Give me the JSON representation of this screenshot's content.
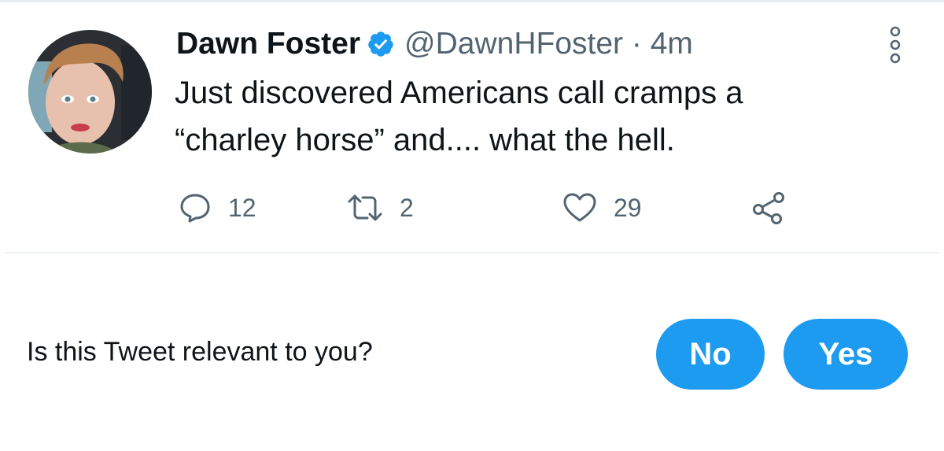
{
  "tweet": {
    "author_name": "Dawn Foster",
    "handle_time": "@DawnHFoster · 4m",
    "text": "Just discovered Americans call cramps a\n“charley horse” and.... what the hell.",
    "verified": true,
    "actions": {
      "reply_count": "12",
      "retweet_count": "2",
      "like_count": "29"
    },
    "icons": {
      "reply": "reply-icon",
      "retweet": "retweet-icon",
      "like": "heart-icon",
      "share": "share-icon",
      "more": "more-vertical-icon",
      "verified": "verified-badge-icon"
    }
  },
  "relevance_prompt": {
    "question": "Is this Tweet relevant to you?",
    "no_label": "No",
    "yes_label": "Yes"
  },
  "colors": {
    "accent": "#1d9bf0",
    "text_primary": "#0f1419",
    "text_secondary": "#536471",
    "divider": "#eef1f3"
  }
}
